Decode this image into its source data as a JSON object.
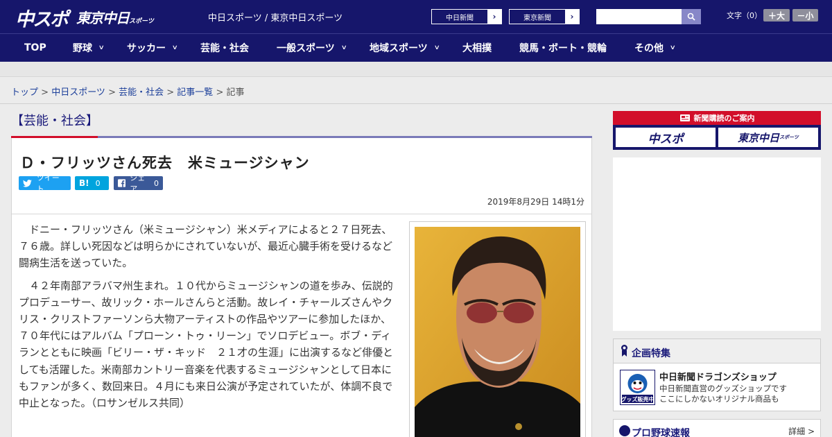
{
  "header": {
    "logo_primary": "中スポ",
    "logo_secondary": "東京中日",
    "logo_secondary_small": "スポーツ",
    "tagline": "中日スポーツ / 東京中日スポーツ",
    "link1": "中日新聞",
    "link2": "東京新聞",
    "search_placeholder": "",
    "font_size_label": "文字（0）",
    "font_larger": "＋大",
    "font_smaller": "－小"
  },
  "nav": [
    "TOP",
    "野球",
    "サッカー",
    "芸能・社会",
    "一般スポーツ",
    "地域スポーツ",
    "大相撲",
    "競馬・ボート・競輪",
    "その他"
  ],
  "breadcrumb": {
    "items": [
      "トップ",
      "中日スポーツ",
      "芸能・社会",
      "記事一覧"
    ],
    "current": "記事",
    "separator": " > "
  },
  "category": "【芸能・社会】",
  "article": {
    "headline": "Ｄ・フリッツさん死去　米ミュージシャン",
    "tweet_label": "ツイート",
    "hatena_label": "B!",
    "hatena_count": "0",
    "share_label": "シェア",
    "share_count": "0",
    "date": "2019年8月29日 14時1分",
    "paragraphs": [
      "ドニー・フリッツさん（米ミュージシャン）米メディアによると２７日死去、７６歳。詳しい死因などは明らかにされていないが、最近心臓手術を受けるなど闘病生活を送っていた。",
      "４２年南部アラバマ州生まれ。１０代からミュージシャンの道を歩み、伝説的プロデューサー、故リック・ホールさんらと活動。故レイ・チャールズさんやクリス・クリストファーソンら大物アーティストの作品やツアーに参加したほか、７０年代にはアルバム「プローン・トゥ・リーン」でソロデビュー。ボブ・ディランとともに映画「ビリー・ザ・キッド　２１才の生涯」に出演するなど俳優としても活躍した。米南部カントリー音楽を代表するミュージシャンとして日本にもファンが多く、数回来日。４月にも来日公演が予定されていたが、体調不良で中止となった。（ロサンゼルス共同）"
    ]
  },
  "sidebar": {
    "subscribe_title": "新聞購読のご案内",
    "subscribe_btn1": "中スポ",
    "subscribe_btn2": "東京中日",
    "subscribe_btn2_small": "スポーツ",
    "feature_title": "企画特集",
    "feature_item_title": "中日新聞ドラゴンズショップ",
    "feature_item_desc1": "中日新聞直営のグッズショップです",
    "feature_item_desc2": "ここにしかないオリジナル商品も",
    "thumb_label": "グッズ販売中",
    "proyakyu_title": "プロ野球速報",
    "proyakyu_more": "詳細 >"
  },
  "colors": {
    "brand_navy": "#16166b",
    "accent_red": "#d20e2a",
    "twitter": "#1da1f2",
    "hatena": "#00a4de",
    "facebook": "#3b5998"
  }
}
